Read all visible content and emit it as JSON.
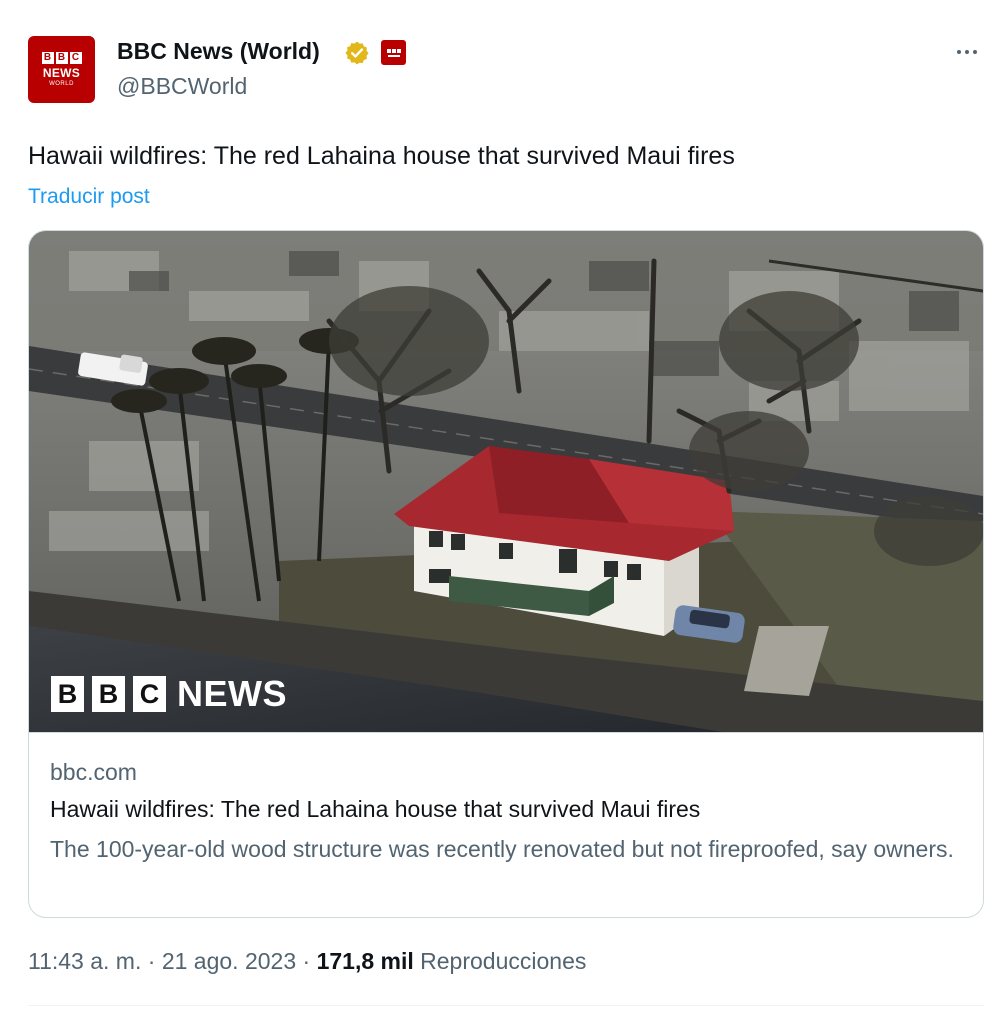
{
  "account": {
    "display_name": "BBC News (World)",
    "handle": "@BBCWorld",
    "avatar_text": {
      "blocks": [
        "B",
        "B",
        "C"
      ],
      "line1": "NEWS",
      "line2": "WORLD"
    }
  },
  "tweet": {
    "text": "Hawaii wildfires: The red Lahaina house that survived Maui fires",
    "translate_label": "Traducir post"
  },
  "card": {
    "overlay_blocks": [
      "B",
      "B",
      "C"
    ],
    "overlay_word": "NEWS",
    "domain": "bbc.com",
    "title": "Hawaii wildfires: The red Lahaina house that survived Maui fires",
    "description": "The 100-year-old wood structure was recently renovated but not fireproofed, say owners."
  },
  "meta": {
    "time": "11:43 a. m.",
    "separator": "·",
    "date": "21 ago. 2023",
    "views": "171,8 mil",
    "views_label": "Reproducciones"
  },
  "colors": {
    "link": "#1d9bf0",
    "secondary_text": "#536471",
    "brand_red": "#b80000",
    "verified_gold": "#e2b719"
  },
  "icons": [
    "verified-gold-icon",
    "affiliate-badge-icon",
    "more-options-icon"
  ]
}
